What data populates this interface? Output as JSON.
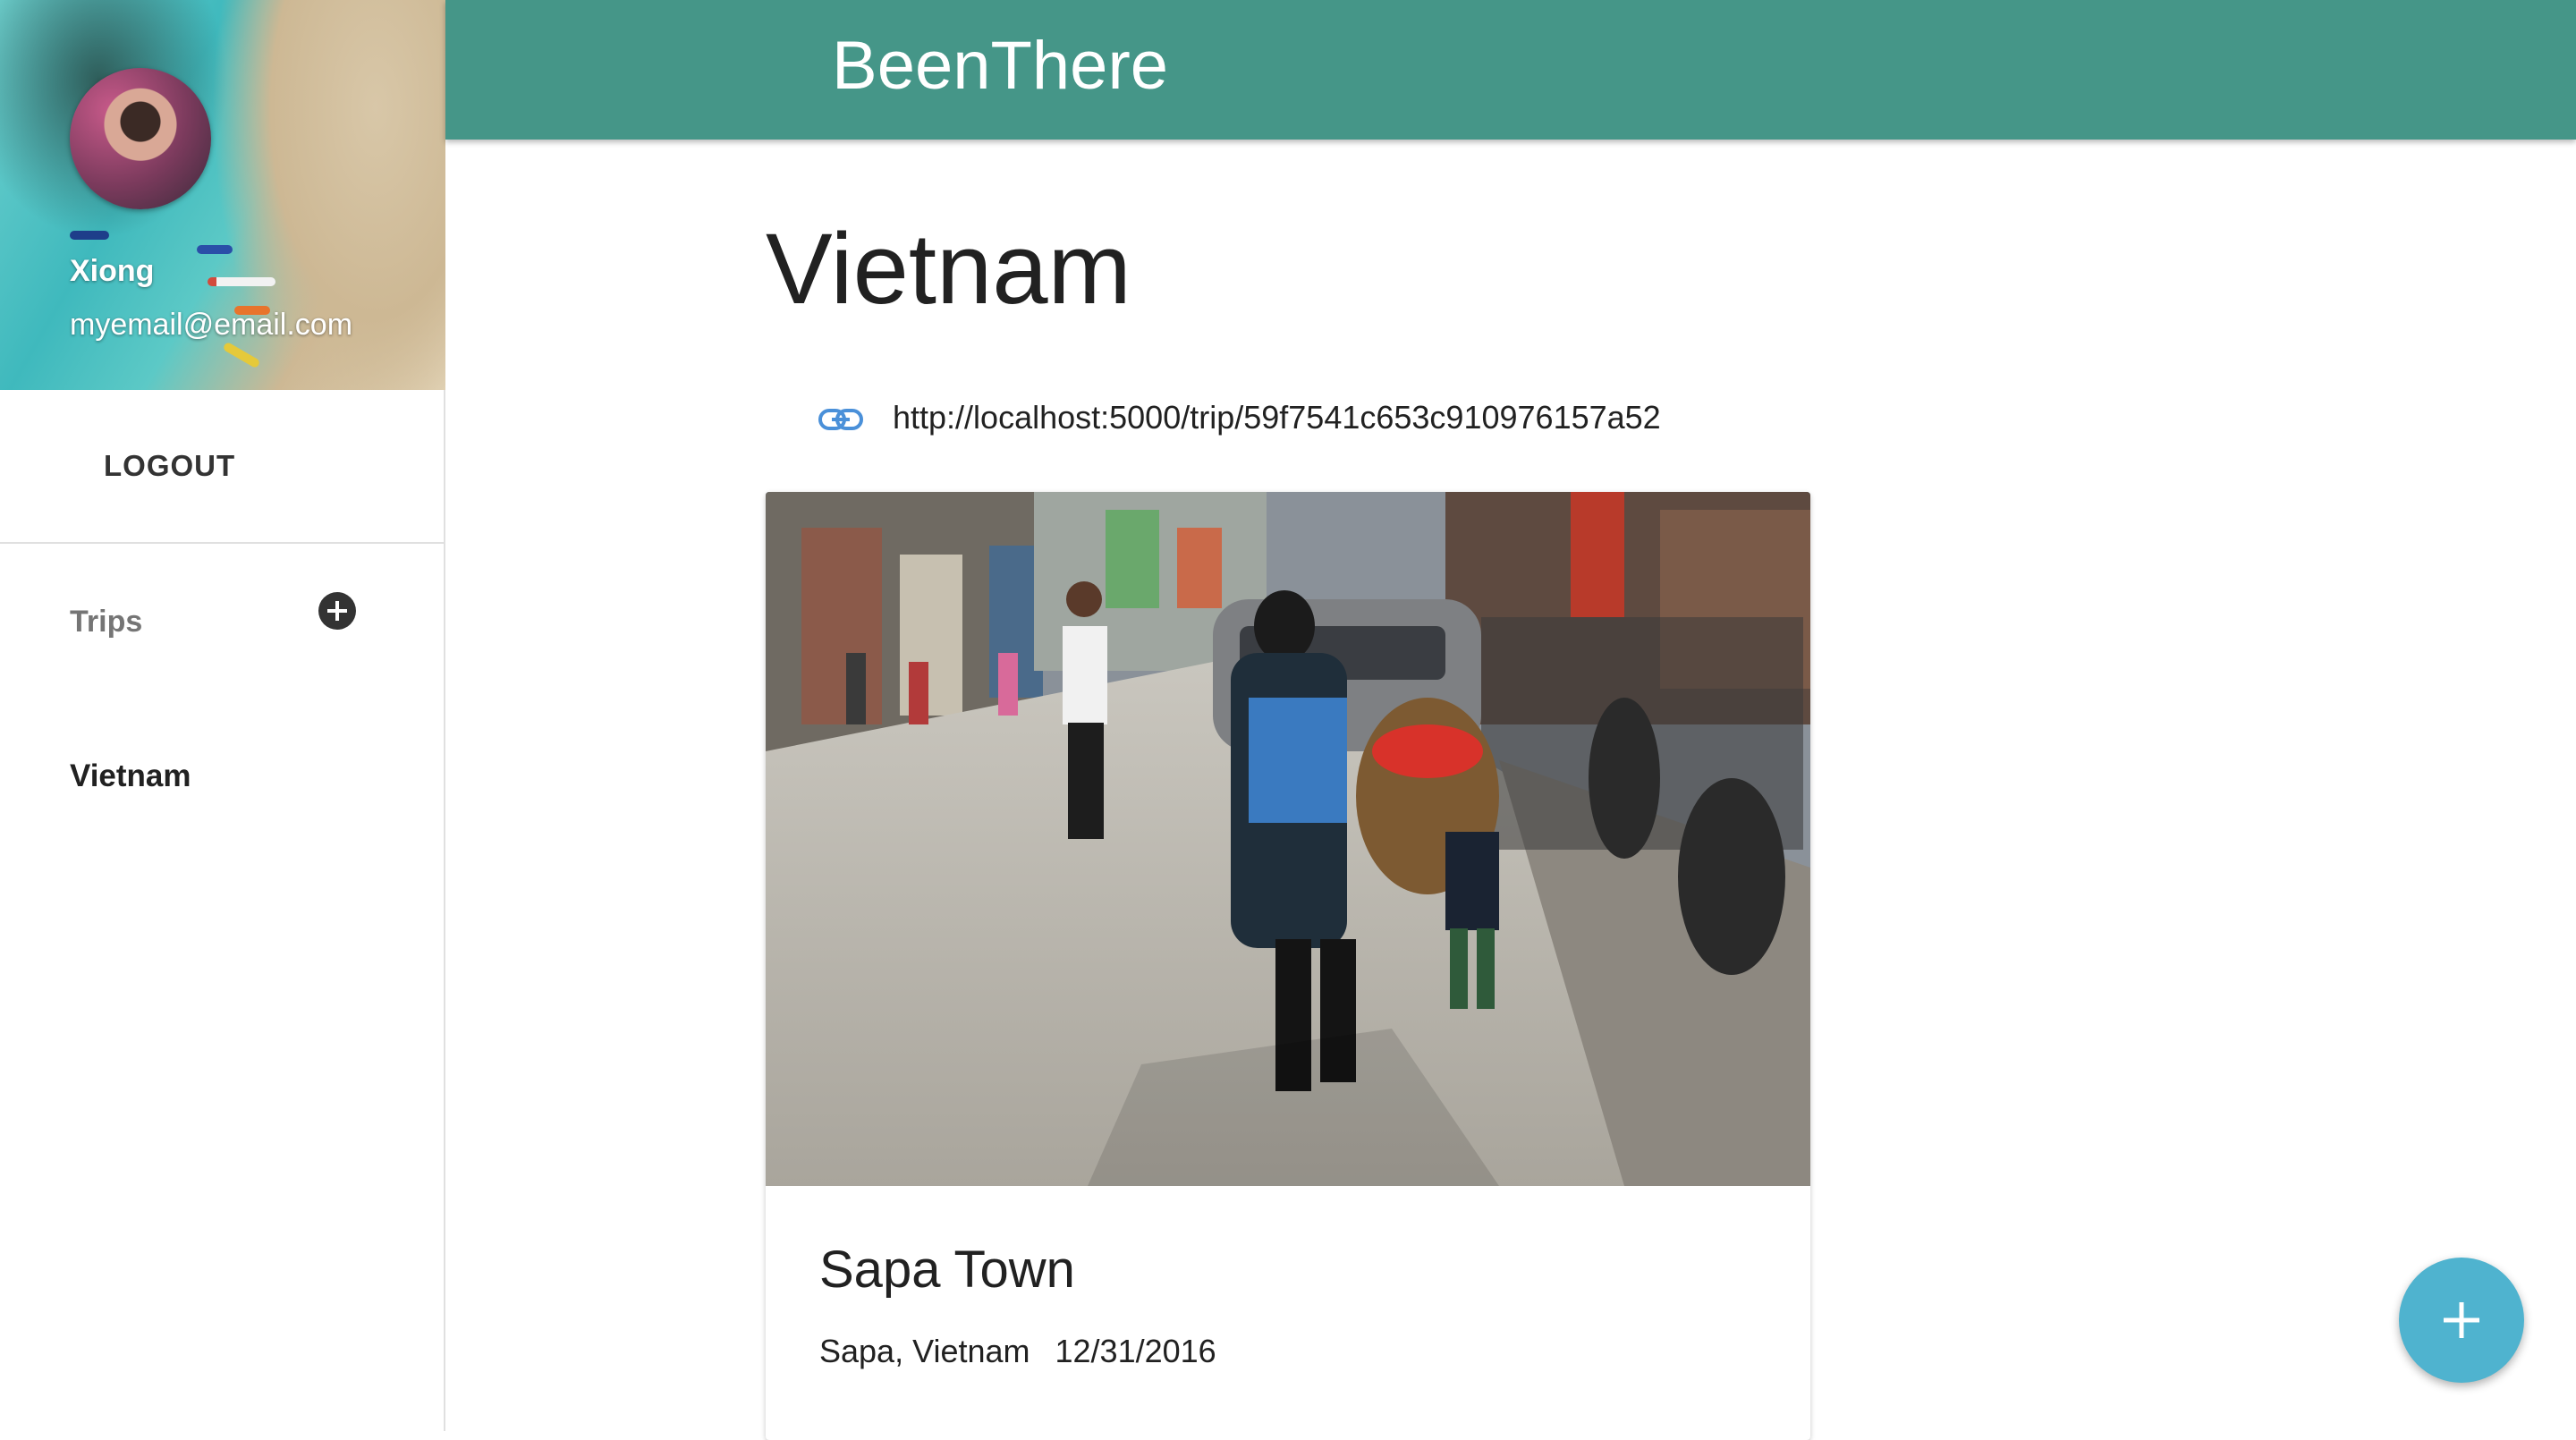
{
  "app": {
    "title": "BeenThere"
  },
  "user": {
    "name": "Xiong",
    "email": "myemail@email.com"
  },
  "sidebar": {
    "logout_label": "LOGOUT",
    "trips_label": "Trips",
    "trips": [
      {
        "label": "Vietnam"
      }
    ]
  },
  "trip": {
    "title": "Vietnam",
    "share_url": "http://localhost:5000/trip/59f7541c653c910976157a52",
    "places": [
      {
        "name": "Sapa Town",
        "location": "Sapa, Vietnam",
        "date": "12/31/2016"
      }
    ]
  },
  "colors": {
    "appbar": "#459688",
    "fab": "#4fb3cf",
    "link_icon": "#4a90d9"
  },
  "icons": {
    "add_trip": "add-circle-icon",
    "share_link": "link-icon",
    "fab": "plus-icon"
  }
}
